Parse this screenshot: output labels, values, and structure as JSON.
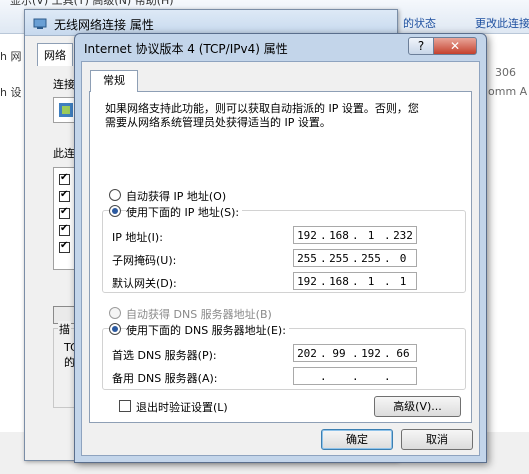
{
  "background_window": {
    "top_clipped_text": "显示(V)    工具(T)    高级(N)    帮助(H)",
    "link_status": "的状态",
    "link_rename": "更改此连接",
    "left_texts": [
      "h 网",
      "h 设"
    ],
    "right_texts": [
      "306",
      "omm A"
    ]
  },
  "middle_window": {
    "title": "无线网络连接 属性",
    "tab": "网络",
    "label_connect": "连接",
    "label_items": "此连",
    "label_desc": "描",
    "desc_lines": [
      "TC",
      "的"
    ]
  },
  "dialog": {
    "title": "Internet 协议版本 4 (TCP/IPv4) 属性",
    "help_button": "?",
    "close_button": "✕",
    "tab_general": "常规",
    "intro_line1": "如果网络支持此功能，则可以获取自动指派的 IP 设置。否则，您",
    "intro_line2": "需要从网络系统管理员处获得适当的 IP 设置。",
    "ip_auto_label": "自动获得 IP 地址(O)",
    "ip_manual_label": "使用下面的 IP 地址(S):",
    "ip_address_label": "IP 地址(I):",
    "ip_address": [
      "192",
      "168",
      "1",
      "232"
    ],
    "subnet_label": "子网掩码(U):",
    "subnet": [
      "255",
      "255",
      "255",
      "0"
    ],
    "gateway_label": "默认网关(D):",
    "gateway": [
      "192",
      "168",
      "1",
      "1"
    ],
    "dns_auto_label": "自动获得 DNS 服务器地址(B)",
    "dns_manual_label": "使用下面的 DNS 服务器地址(E):",
    "dns_pref_label": "首选 DNS 服务器(P):",
    "dns_pref": [
      "202",
      "99",
      "192",
      "66"
    ],
    "dns_alt_label": "备用 DNS 服务器(A):",
    "dns_alt": [
      "",
      "",
      "",
      ""
    ],
    "validate_label": "退出时验证设置(L)",
    "advanced_button": "高级(V)...",
    "ok_button": "确定",
    "cancel_button": "取消",
    "state": {
      "ip_mode": "manual",
      "dns_mode": "manual",
      "validate_on_exit": false
    }
  }
}
